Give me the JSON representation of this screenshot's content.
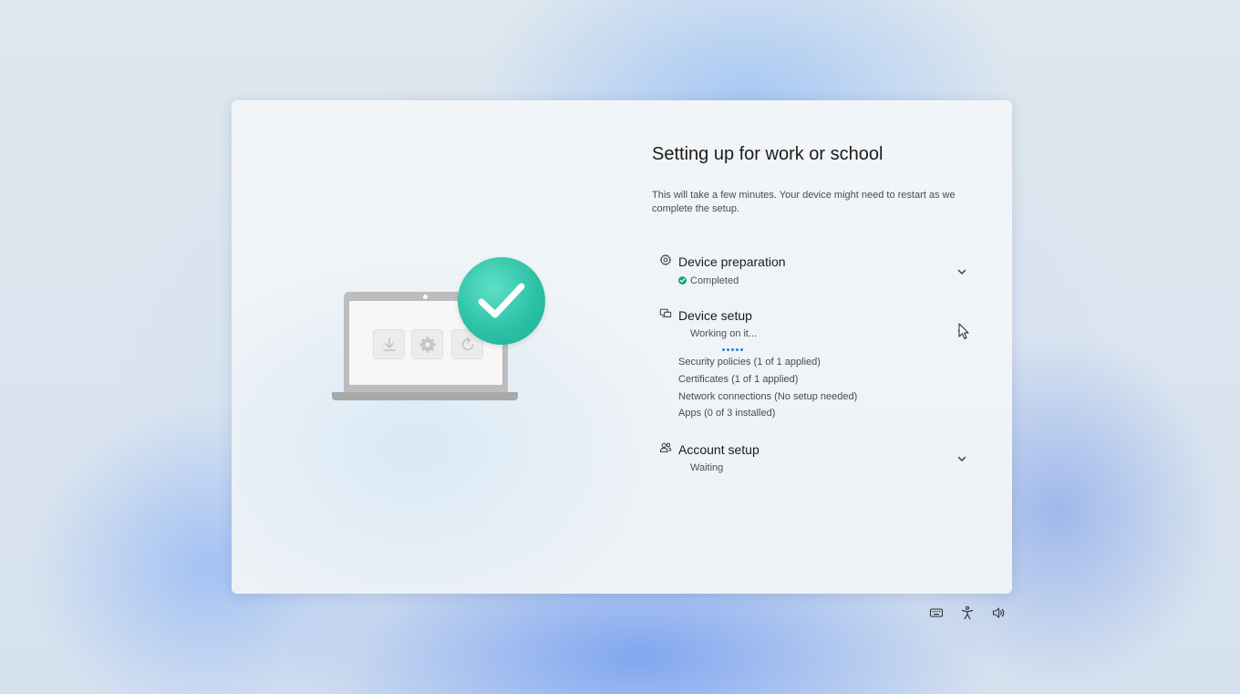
{
  "window": {
    "title": "Setting up for work or school",
    "subtitle": "This will take a few minutes. Your device might need to restart as we complete the setup."
  },
  "illustration": {
    "tiles": [
      "download-icon",
      "gear-icon",
      "refresh-icon"
    ],
    "badge": "checkmark-icon",
    "badge_color": "#2cc2a6"
  },
  "sections": [
    {
      "icon": "gear-icon",
      "title": "Device preparation",
      "status": "Completed",
      "status_color": "#1aa37a",
      "expanded": false
    },
    {
      "icon": "devices-icon",
      "title": "Device setup",
      "status": "Working on it...",
      "expanded": true,
      "details": [
        "Security policies (1 of 1 applied)",
        "Certificates (1 of 1 applied)",
        "Network connections (No setup needed)",
        "Apps (0 of 3 installed)"
      ]
    },
    {
      "icon": "people-icon",
      "title": "Account setup",
      "status": "Waiting",
      "expanded": false
    }
  ],
  "system_tray": [
    "keyboard-icon",
    "accessibility-icon",
    "volume-icon"
  ],
  "colors": {
    "accent": "#2b7de0",
    "success": "#1aa37a"
  }
}
